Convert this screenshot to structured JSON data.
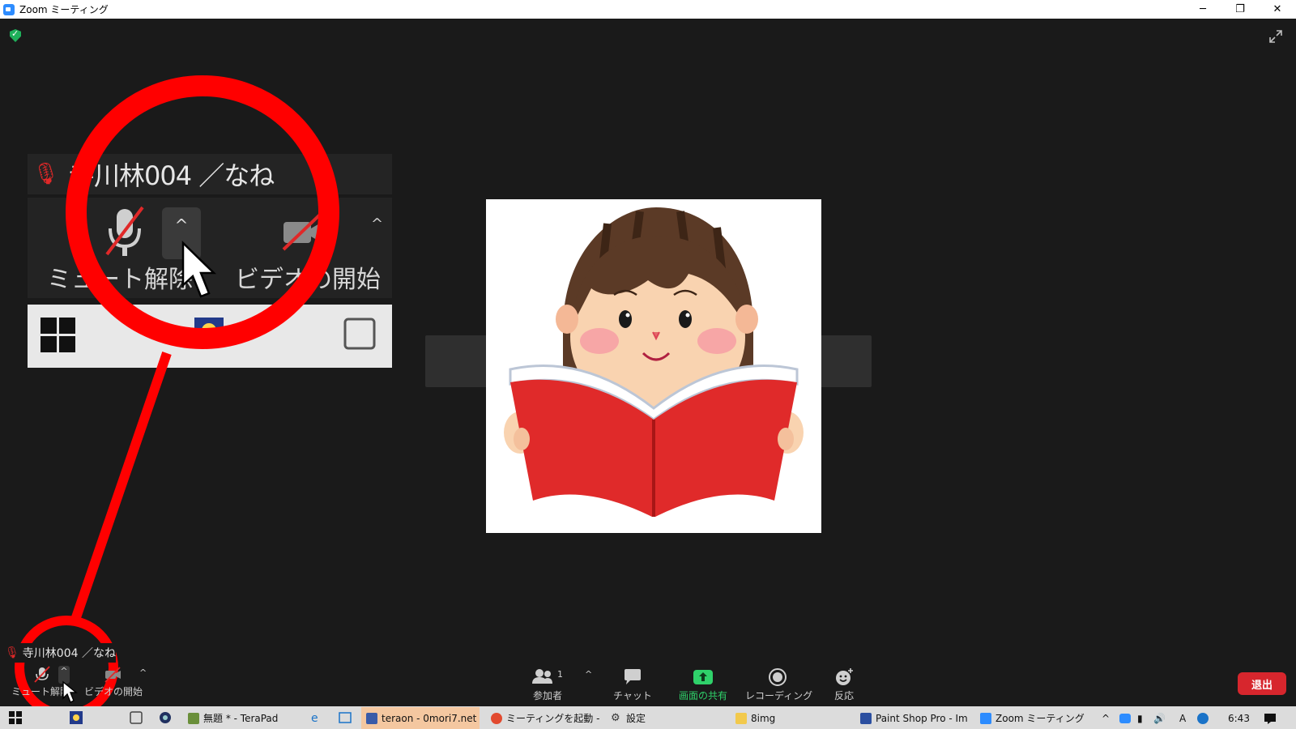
{
  "window": {
    "title": "Zoom ミーティング",
    "minimize_glyph": "─",
    "restore_glyph": "❐",
    "close_glyph": "✕"
  },
  "inset": {
    "participant_name": "寺川林004 ／なね",
    "unmute_label": "ミュート解除",
    "video_label": "ビデオの開始"
  },
  "self_view": {
    "participant_name": "寺川林004 ／なね"
  },
  "controls": {
    "unmute_label": "ミュート解除",
    "video_label": "ビデオの開始",
    "participants_label": "参加者",
    "participants_count": "1",
    "chat_label": "チャット",
    "share_label": "画面の共有",
    "record_label": "レコーディング",
    "reactions_label": "反応",
    "leave_label": "退出"
  },
  "taskbar": {
    "items": [
      {
        "label": "無題 * - TeraPad",
        "active": false
      },
      {
        "label": "teraon - 0mori7.net ...",
        "active": true
      },
      {
        "label": "ミーティングを起動 - Z...",
        "active": false
      },
      {
        "label": "設定",
        "active": false
      },
      {
        "label": "8img",
        "active": false
      },
      {
        "label": "Paint Shop Pro - Im...",
        "active": false
      },
      {
        "label": "Zoom ミーティング",
        "active": false
      }
    ],
    "clock": "6:43",
    "ime_indicator": "A"
  },
  "colors": {
    "zoom_blue": "#2d8cff",
    "share_green": "#2fd16a",
    "leave_red": "#d7262d",
    "annotation_red": "#ff0000"
  }
}
